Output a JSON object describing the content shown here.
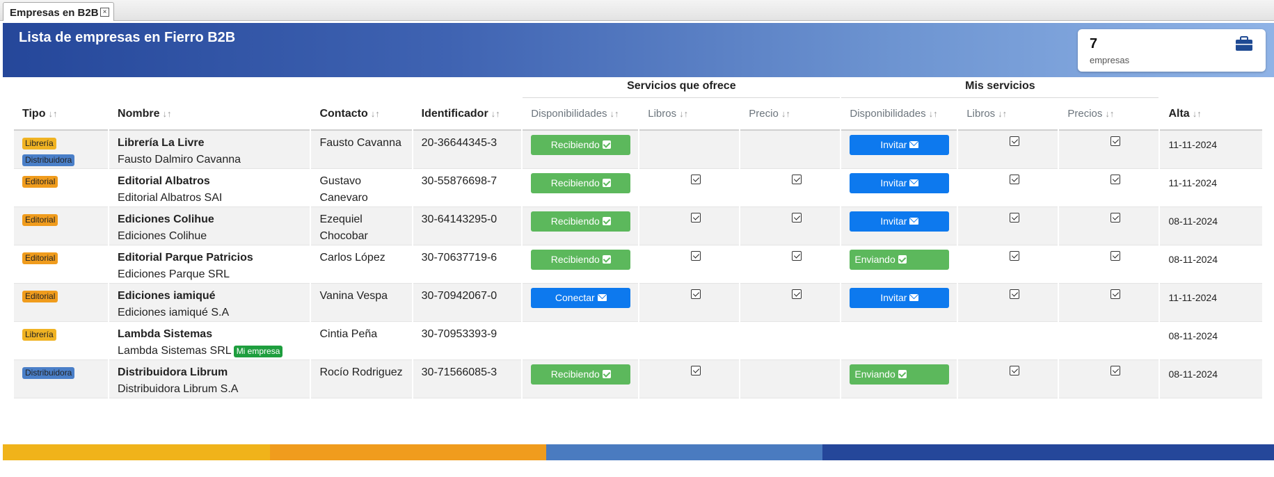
{
  "tab": {
    "title": "Empresas en B2B",
    "close_icon": "close-box-icon"
  },
  "header": {
    "title": "Lista de empresas en Fierro B2B",
    "count": "7",
    "count_label": "empresas",
    "icon": "briefcase-icon"
  },
  "groups": {
    "servicios_ofrece": "Servicios que ofrece",
    "mis_servicios": "Mis servicios"
  },
  "columns": {
    "tipo": "Tipo",
    "nombre": "Nombre",
    "contacto": "Contacto",
    "identificador": "Identificador",
    "disp1": "Disponibilidades",
    "libros1": "Libros",
    "precio1": "Precio",
    "disp2": "Disponibilidades",
    "libros2": "Libros",
    "precios2": "Precios",
    "alta": "Alta",
    "sort_glyph": "↓↑"
  },
  "rows": [
    {
      "badges": [
        "Librería",
        "Distribuidora"
      ],
      "name": "Librería La Livre",
      "legal": "Fausto Dalmiro Cavanna",
      "contact": "Fausto Cavanna",
      "id": "20-36644345-3",
      "disp1": "Recibiendo",
      "libros1": false,
      "precio1": false,
      "disp2": "Invitar",
      "libros2": true,
      "precios2": true,
      "alta": "11-11-2024"
    },
    {
      "badges": [
        "Editorial"
      ],
      "name": "Editorial Albatros",
      "legal": "Editorial Albatros SAI",
      "contact": "Gustavo Canevaro",
      "id": "30-55876698-7",
      "disp1": "Recibiendo",
      "libros1": true,
      "precio1": true,
      "disp2": "Invitar",
      "libros2": true,
      "precios2": true,
      "alta": "11-11-2024"
    },
    {
      "badges": [
        "Editorial"
      ],
      "name": "Ediciones Colihue",
      "legal": "Ediciones Colihue",
      "contact": "Ezequiel Chocobar",
      "id": "30-64143295-0",
      "disp1": "Recibiendo",
      "libros1": true,
      "precio1": true,
      "disp2": "Invitar",
      "libros2": true,
      "precios2": true,
      "alta": "08-11-2024"
    },
    {
      "badges": [
        "Editorial"
      ],
      "name": "Editorial Parque Patricios",
      "legal": "Ediciones Parque SRL",
      "contact": "Carlos López",
      "id": "30-70637719-6",
      "disp1": "Recibiendo",
      "libros1": true,
      "precio1": true,
      "disp2": "Enviando",
      "libros2": true,
      "precios2": true,
      "alta": "08-11-2024"
    },
    {
      "badges": [
        "Editorial"
      ],
      "name": "Ediciones iamiqué",
      "legal": "Ediciones iamiqué S.A",
      "contact": "Vanina Vespa",
      "id": "30-70942067-0",
      "disp1": "Conectar",
      "libros1": true,
      "precio1": true,
      "disp2": "Invitar",
      "libros2": true,
      "precios2": true,
      "alta": "11-11-2024"
    },
    {
      "badges": [
        "Librería"
      ],
      "name": "Lambda Sistemas",
      "legal": "Lambda Sistemas SRL",
      "mine": "Mi empresa",
      "contact": "Cintia Peña",
      "id": "30-70953393-9",
      "disp1": "",
      "libros1": false,
      "precio1": false,
      "disp2": "",
      "libros2": false,
      "precios2": false,
      "alta": "08-11-2024"
    },
    {
      "badges": [
        "Distribuidora"
      ],
      "name": "Distribuidora Librum",
      "legal": "Distribuidora Librum S.A",
      "contact": "Rocío Rodriguez",
      "id": "30-71566085-3",
      "disp1": "Recibiendo",
      "libros1": true,
      "precio1": false,
      "disp2": "Enviando",
      "libros2": true,
      "precios2": true,
      "alta": "08-11-2024"
    }
  ],
  "colors": {
    "accent_green": "#5cb85c",
    "accent_blue": "#0d79ee",
    "badge_libreria": "#f0b323",
    "badge_distribuidora": "#4a7fc8",
    "badge_editorial": "#f09c1d",
    "footer": [
      "#f0b31a",
      "#f09c1d",
      "#4a7bc0",
      "#25479a"
    ]
  }
}
